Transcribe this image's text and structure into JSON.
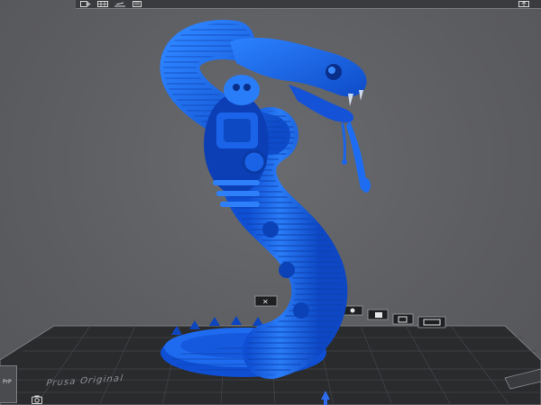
{
  "app": {
    "view": "3d-viewport"
  },
  "toolbar": {
    "buttons": [
      {
        "id": "add",
        "icon": "add-model-icon"
      },
      {
        "id": "grid",
        "icon": "arrange-grid-icon"
      },
      {
        "id": "orient",
        "icon": "orient-icon"
      },
      {
        "id": "slice",
        "icon": "slice-icon"
      }
    ],
    "right_button_icon": "export-icon"
  },
  "bed_buttons": [
    {
      "icon": "cross-icon"
    },
    {
      "icon": "dot-icon"
    },
    {
      "icon": "mirror-icon"
    },
    {
      "icon": "drop-icon"
    },
    {
      "icon": "square-icon"
    },
    {
      "icon": "layers-icon"
    }
  ],
  "bed": {
    "label": "Prusa Original"
  },
  "corner_widget": {
    "label": "PrP"
  },
  "colors": {
    "model": "#1e6ff0",
    "bed": "#2a2b2d",
    "grid_line": "#4b4c50",
    "background": "#5f6062"
  }
}
